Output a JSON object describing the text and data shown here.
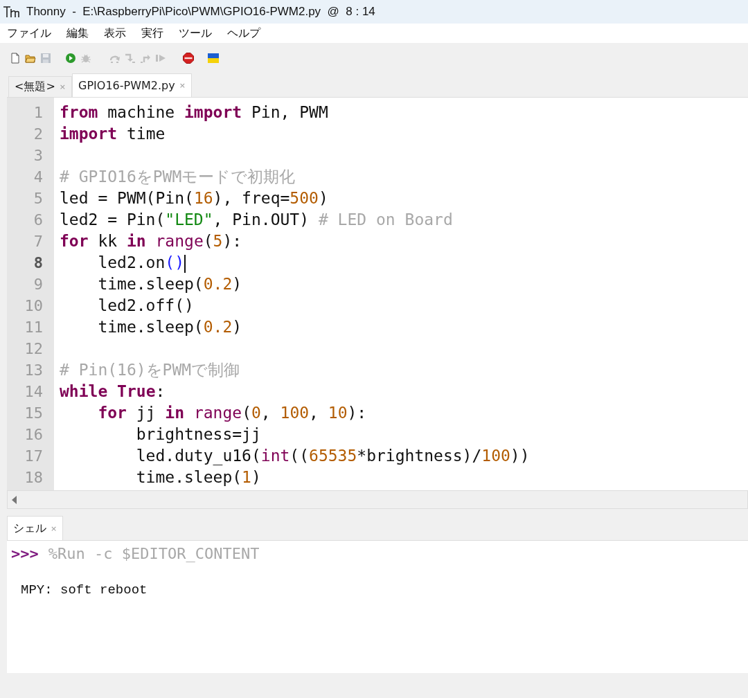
{
  "window": {
    "title": "Thonny  -  E:\\RaspberryPi\\Pico\\PWM\\GPIO16-PWM2.py  @  8 : 14"
  },
  "menu": [
    "ファイル",
    "編集",
    "表示",
    "実行",
    "ツール",
    "ヘルプ"
  ],
  "toolbar": [
    {
      "kind": "new",
      "disabled": false
    },
    {
      "kind": "open",
      "disabled": false
    },
    {
      "kind": "save",
      "disabled": true
    },
    {
      "kind": "run",
      "disabled": false
    },
    {
      "kind": "debug",
      "disabled": true
    },
    {
      "kind": "step_over",
      "disabled": true
    },
    {
      "kind": "step_into",
      "disabled": true
    },
    {
      "kind": "step_out",
      "disabled": true
    },
    {
      "kind": "resume",
      "disabled": true
    },
    {
      "kind": "stop",
      "disabled": false
    },
    {
      "kind": "flag",
      "disabled": false
    }
  ],
  "tabs": [
    {
      "label": "<無題>",
      "close": "×",
      "selected": false
    },
    {
      "label": "GPIO16-PWM2.py",
      "close": "×",
      "selected": true
    }
  ],
  "editor": {
    "lines": [
      {
        "number": "1",
        "current": false,
        "tokens": [
          {
            "kind": "keyword",
            "text": "from"
          },
          {
            "kind": "plain",
            "text": " machine "
          },
          {
            "kind": "keyword",
            "text": "import"
          },
          {
            "kind": "plain",
            "text": " Pin, PWM"
          }
        ]
      },
      {
        "number": "2",
        "current": false,
        "tokens": [
          {
            "kind": "keyword",
            "text": "import"
          },
          {
            "kind": "plain",
            "text": " time"
          }
        ]
      },
      {
        "number": "3",
        "current": false
      },
      {
        "number": "4",
        "current": false,
        "tokens": [
          {
            "kind": "comment",
            "text": "# GPIO16をPWMモードで初期化"
          }
        ]
      },
      {
        "number": "5",
        "current": false,
        "tokens": [
          {
            "kind": "plain",
            "text": "led = PWM(Pin("
          },
          {
            "kind": "number",
            "text": "16"
          },
          {
            "kind": "plain",
            "text": "), freq="
          },
          {
            "kind": "number",
            "text": "500"
          },
          {
            "kind": "plain",
            "text": ")"
          }
        ]
      },
      {
        "number": "6",
        "current": false,
        "tokens": [
          {
            "kind": "plain",
            "text": "led2 = Pin("
          },
          {
            "kind": "string",
            "text": "\"LED\""
          },
          {
            "kind": "plain",
            "text": ", Pin.OUT) "
          },
          {
            "kind": "comment",
            "text": "# LED on Board"
          }
        ]
      },
      {
        "number": "7",
        "current": false,
        "tokens": [
          {
            "kind": "keyword",
            "text": "for"
          },
          {
            "kind": "plain",
            "text": " kk "
          },
          {
            "kind": "keyword",
            "text": "in"
          },
          {
            "kind": "builtin",
            "text": " range"
          },
          {
            "kind": "plain",
            "text": "("
          },
          {
            "kind": "number",
            "text": "5"
          },
          {
            "kind": "plain",
            "text": "):"
          }
        ]
      },
      {
        "number": "8",
        "current": true,
        "tokens": [
          {
            "kind": "plain",
            "text": "    led2.on"
          },
          {
            "kind": "bracket_match",
            "text": "()"
          }
        ]
      },
      {
        "number": "9",
        "current": false,
        "tokens": [
          {
            "kind": "plain",
            "text": "    time.sleep("
          },
          {
            "kind": "number",
            "text": "0.2"
          },
          {
            "kind": "plain",
            "text": ")"
          }
        ]
      },
      {
        "number": "10",
        "current": false,
        "tokens": [
          {
            "kind": "plain",
            "text": "    led2.off()"
          }
        ]
      },
      {
        "number": "11",
        "current": false,
        "tokens": [
          {
            "kind": "plain",
            "text": "    time.sleep("
          },
          {
            "kind": "number",
            "text": "0.2"
          },
          {
            "kind": "plain",
            "text": ")"
          }
        ]
      },
      {
        "number": "12",
        "current": false
      },
      {
        "number": "13",
        "current": false,
        "tokens": [
          {
            "kind": "comment",
            "text": "# Pin(16)をPWMで制御"
          }
        ]
      },
      {
        "number": "14",
        "current": false,
        "tokens": [
          {
            "kind": "keyword",
            "text": "while"
          },
          {
            "kind": "keyword",
            "text": " True"
          },
          {
            "kind": "plain",
            "text": ":"
          }
        ]
      },
      {
        "number": "15",
        "current": false,
        "tokens": [
          {
            "kind": "keyword",
            "text": "    for"
          },
          {
            "kind": "plain",
            "text": " jj "
          },
          {
            "kind": "keyword",
            "text": "in"
          },
          {
            "kind": "builtin",
            "text": " range"
          },
          {
            "kind": "plain",
            "text": "("
          },
          {
            "kind": "number",
            "text": "0"
          },
          {
            "kind": "plain",
            "text": ", "
          },
          {
            "kind": "number",
            "text": "100"
          },
          {
            "kind": "plain",
            "text": ", "
          },
          {
            "kind": "number",
            "text": "10"
          },
          {
            "kind": "plain",
            "text": "):"
          }
        ]
      },
      {
        "number": "16",
        "current": false,
        "tokens": [
          {
            "kind": "plain",
            "text": "        brightness=jj"
          }
        ]
      },
      {
        "number": "17",
        "current": false,
        "tokens": [
          {
            "kind": "plain",
            "text": "        led.duty_u16("
          },
          {
            "kind": "builtin",
            "text": "int"
          },
          {
            "kind": "plain",
            "text": "(("
          },
          {
            "kind": "number",
            "text": "65535"
          },
          {
            "kind": "plain",
            "text": "*brightness)/"
          },
          {
            "kind": "number",
            "text": "100"
          },
          {
            "kind": "plain",
            "text": "))"
          }
        ]
      },
      {
        "number": "18",
        "current": false,
        "tokens": [
          {
            "kind": "plain",
            "text": "        time.sleep("
          },
          {
            "kind": "number",
            "text": "1"
          },
          {
            "kind": "plain",
            "text": ")"
          }
        ]
      }
    ]
  },
  "shell": {
    "tab": {
      "label": "シェル",
      "close": "×"
    },
    "lines": [
      {
        "kind": "command",
        "prompt": ">>>",
        "text": "%Run -c $EDITOR_CONTENT"
      },
      {
        "kind": "output",
        "text": "MPY: soft reboot"
      }
    ]
  }
}
